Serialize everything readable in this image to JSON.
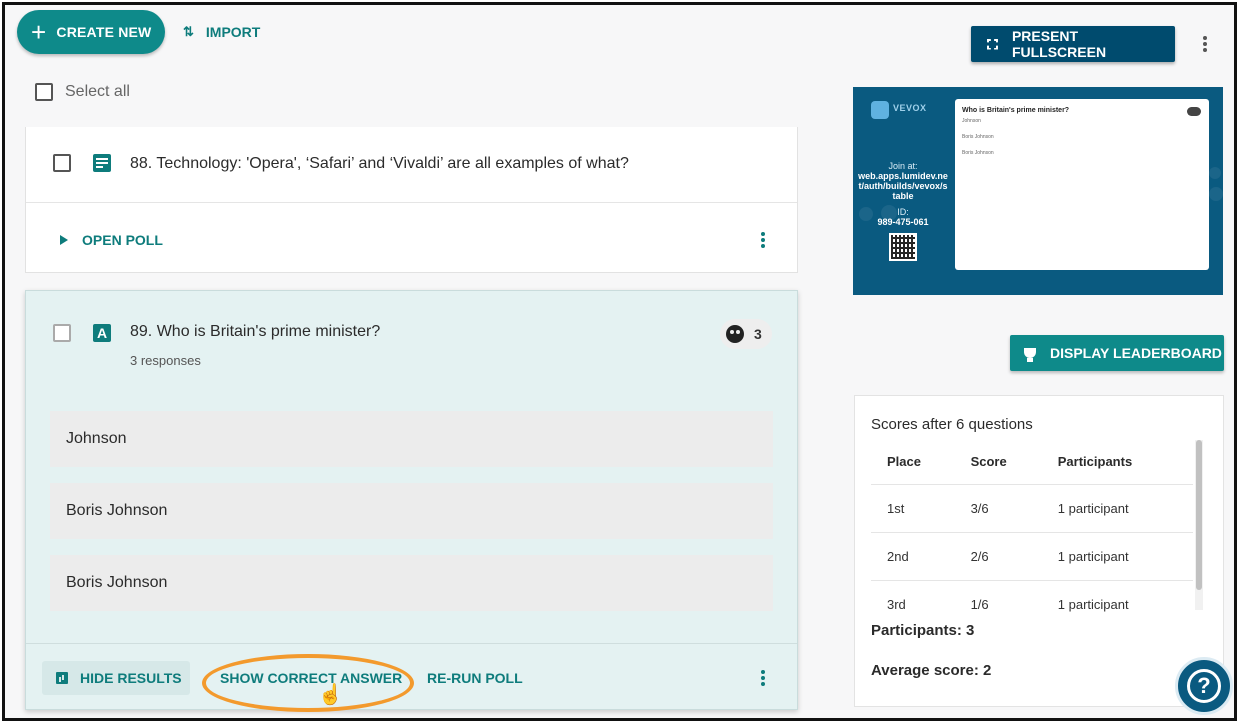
{
  "toolbar": {
    "create_label": "CREATE NEW",
    "import_label": "IMPORT",
    "present_label": "PRESENT FULLSCREEN"
  },
  "list": {
    "select_all_label": "Select all"
  },
  "poll88": {
    "title": "88. Technology: 'Opera', ‘Safari’ and ‘Vivaldi’ are all examples of what?",
    "open_label": "OPEN POLL"
  },
  "poll89": {
    "title": "89. Who is Britain's prime minister?",
    "responses_text": "3 responses",
    "participant_count": "3",
    "answers": [
      "Johnson",
      "Boris Johnson",
      "Boris Johnson"
    ],
    "hide_results_label": "HIDE RESULTS",
    "show_answer_label": "SHOW CORRECT ANSWER",
    "rerun_label": "RE-RUN POLL"
  },
  "preview": {
    "logo_text": "VEVOX",
    "join_at_label": "Join at:",
    "join_url": "web.apps.lumidev.net/auth/builds/vevox/stable",
    "id_label": "ID:",
    "id_value": "989-475-061",
    "slide_title": "Who is Britain's prime minister?",
    "slide_answers": [
      "Johnson",
      "Boris Johnson",
      "Boris Johnson"
    ]
  },
  "leaderboard": {
    "display_label": "DISPLAY LEADERBOARD",
    "title": "Scores after 6 questions",
    "columns": [
      "Place",
      "Score",
      "Participants"
    ],
    "rows": [
      [
        "1st",
        "3/6",
        "1 participant"
      ],
      [
        "2nd",
        "2/6",
        "1 participant"
      ],
      [
        "3rd",
        "1/6",
        "1 participant"
      ]
    ],
    "participants_text": "Participants: 3",
    "average_text": "Average score: 2"
  },
  "colors": {
    "teal": "#0e8a8a",
    "navy": "#004b6e",
    "highlight": "#f39a2d"
  }
}
